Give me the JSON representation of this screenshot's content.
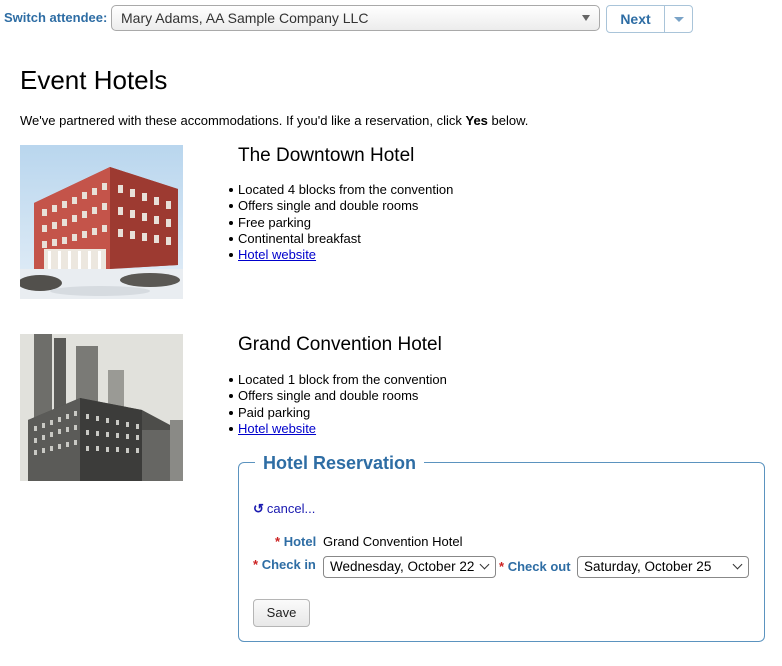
{
  "topbar": {
    "switch_label": "Switch attendee:",
    "attendee_selected": "Mary Adams, AA Sample Company LLC",
    "next_label": "Next"
  },
  "page": {
    "title": "Event Hotels",
    "intro_prefix": "We've partnered with these accommodations. If you'd like a reservation, click ",
    "intro_bold": "Yes",
    "intro_suffix": " below."
  },
  "hotels": [
    {
      "name": "The Downtown Hotel",
      "features": [
        "Located 4 blocks from the convention",
        "Offers single and double rooms",
        "Free parking",
        "Continental breakfast"
      ],
      "link": "Hotel website"
    },
    {
      "name": "Grand Convention Hotel",
      "features": [
        "Located 1 block from the convention",
        "Offers single and double rooms",
        "Paid parking"
      ],
      "link": "Hotel website"
    }
  ],
  "reservation": {
    "legend": "Hotel Reservation",
    "cancel": "cancel...",
    "required_mark": "*",
    "hotel_label": "Hotel",
    "hotel_value": "Grand Convention Hotel",
    "checkin_label": "Check in",
    "checkin_value": "Wednesday, October 22",
    "checkout_label": "Check out",
    "checkout_value": "Saturday, October 25",
    "save_label": "Save"
  },
  "icons": {
    "undo": "undo-icon",
    "dropdown": "chevron-down-icon"
  },
  "colors": {
    "accent": "#2e6da4",
    "required": "#cc2222",
    "link": "#0000cc"
  }
}
